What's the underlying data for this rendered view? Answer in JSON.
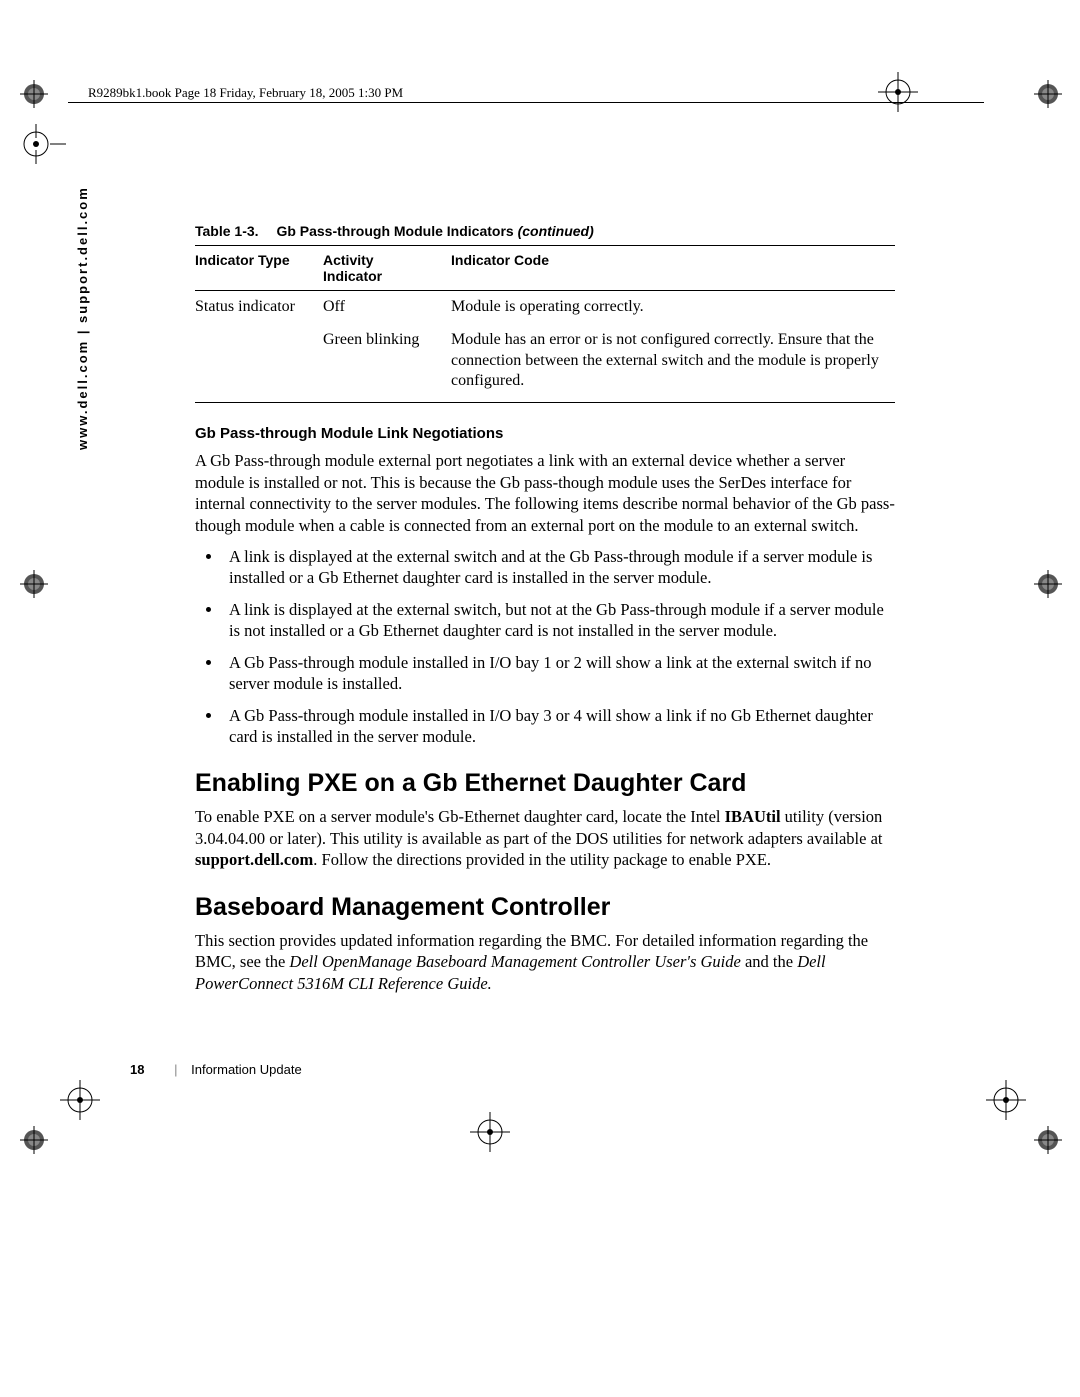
{
  "header_line": "R9289bk1.book  Page 18  Friday, February 18, 2005  1:30 PM",
  "sidetext": "www.dell.com | support.dell.com",
  "table": {
    "caption_label": "Table 1-3.",
    "caption_title": "Gb Pass-through Module Indicators ",
    "caption_cont": "(continued)",
    "headers": {
      "c1": "Indicator Type",
      "c2_l1": "Activity",
      "c2_l2": "Indicator",
      "c3": "Indicator Code"
    },
    "rows": [
      {
        "c1": "Status indicator",
        "c2": "Off",
        "c3": "Module is operating correctly."
      },
      {
        "c1": "",
        "c2": "Green blinking",
        "c3": "Module has an error or is not configured correctly. Ensure that the connection between the external switch and the module is properly configured."
      }
    ]
  },
  "subheading1": "Gb Pass-through Module Link Negotiations",
  "para1": "A Gb Pass-through module external port negotiates a link with an external device whether a server module is installed or not. This is because the Gb pass-though module uses the SerDes interface for internal connectivity to the server modules. The following items describe normal behavior of the Gb pass-though module when a cable is connected from an external port on the module to an external switch.",
  "bullets": [
    "A link is displayed at the external switch and at the Gb Pass-through module if a server module is installed or a Gb Ethernet daughter card is installed in the server module.",
    "A link is displayed at the external switch, but not at the Gb Pass-through module if a server module is not installed or a Gb Ethernet daughter card is not installed in the server module.",
    "A Gb Pass-through module installed in I/O bay 1 or 2 will show a link at the external switch if no server module is installed.",
    "A Gb Pass-through module installed in I/O bay 3 or 4 will show a link if no Gb Ethernet daughter card is installed in the server module."
  ],
  "heading2": "Enabling PXE on a Gb Ethernet Daughter Card",
  "para2_pre": "To enable PXE on a server module's Gb-Ethernet daughter card, locate the Intel ",
  "para2_bold1": "IBAUtil",
  "para2_mid": " utility (version 3.04.04.00 or later). This utility is available as part of the DOS utilities for network adapters available at ",
  "para2_bold2": "support.dell.com",
  "para2_post": ". Follow the directions provided in the utility package to enable PXE.",
  "heading3": "Baseboard Management Controller",
  "para3_pre": "This section provides updated information regarding the BMC. For detailed information regarding the BMC, see the ",
  "para3_it1": "Dell OpenManage Baseboard Management Controller User's Guide",
  "para3_mid": " and the ",
  "para3_it2": "Dell PowerConnect 5316M CLI Reference Guide.",
  "footer": {
    "page": "18",
    "section": "Information Update"
  }
}
